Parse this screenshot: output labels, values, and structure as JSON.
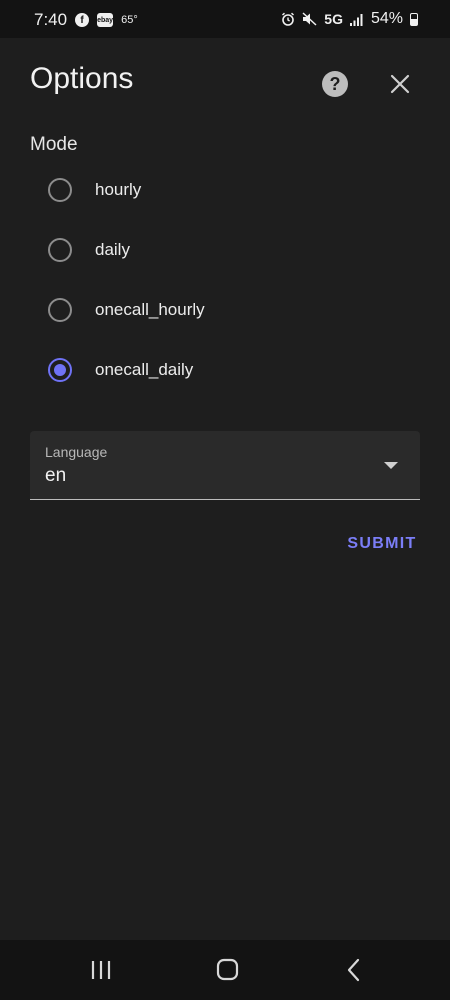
{
  "status_bar": {
    "time": "7:40",
    "temperature": "65°",
    "ebay_label": "ebay",
    "network": "5G",
    "battery": "54%",
    "battery_level": 0.54
  },
  "header": {
    "title": "Options"
  },
  "mode": {
    "label": "Mode",
    "options": [
      {
        "label": "hourly",
        "checked": false
      },
      {
        "label": "daily",
        "checked": false
      },
      {
        "label": "onecall_hourly",
        "checked": false
      },
      {
        "label": "onecall_daily",
        "checked": true
      }
    ]
  },
  "language": {
    "label": "Language",
    "value": "en"
  },
  "actions": {
    "submit_label": "SUBMIT"
  },
  "colors": {
    "accent": "#6f72f5",
    "background": "#1e1e1e"
  }
}
